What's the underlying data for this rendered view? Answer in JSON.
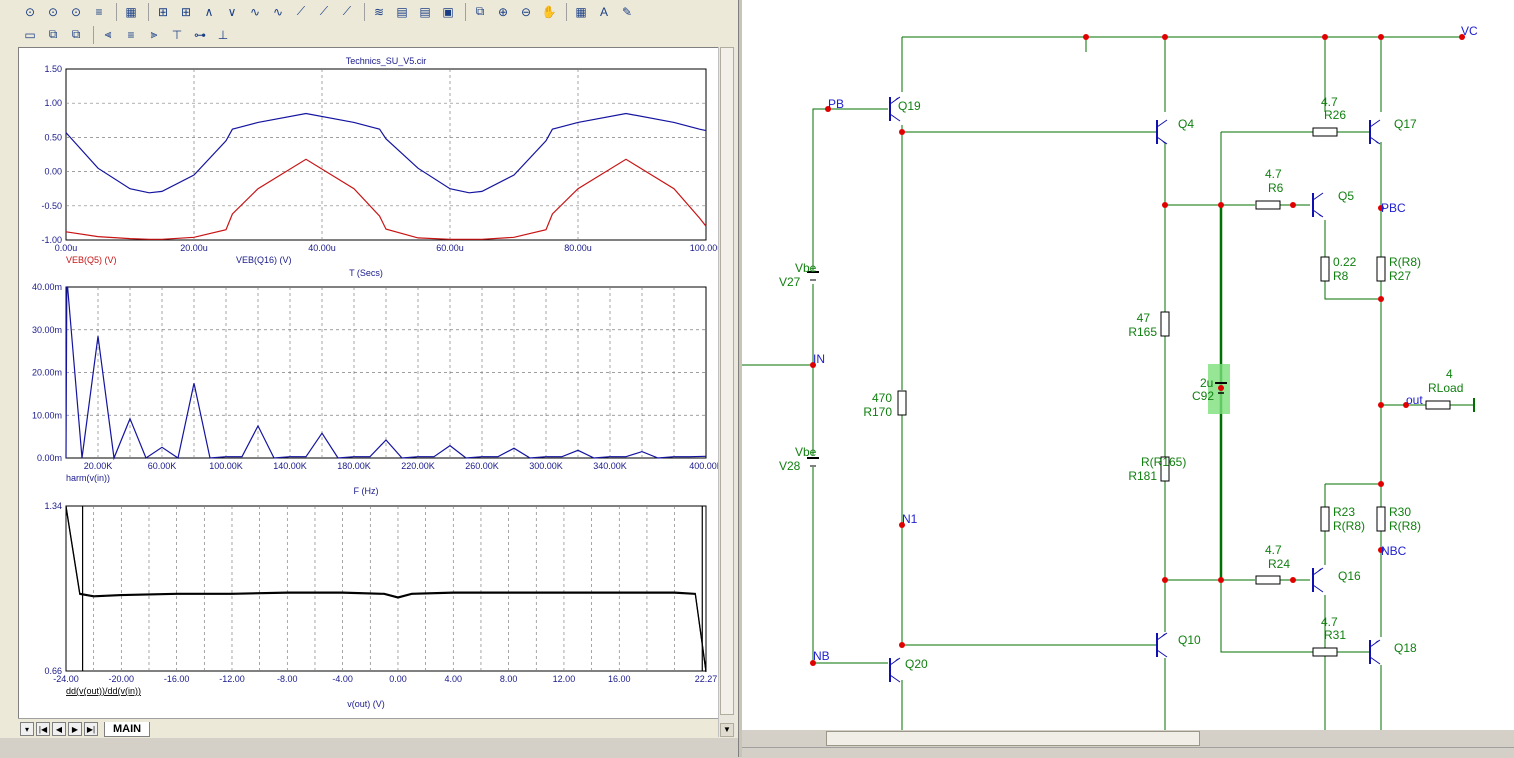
{
  "toolbar": {
    "row1_icons": [
      "zoom-fit-icon",
      "zoom-region-icon",
      "zoom-out-icon",
      "scale-icon",
      "properties-icon",
      "cursor-peak-icon",
      "cursor-valley-icon",
      "cursor-high-icon",
      "cursor-low-icon",
      "cursor-inflection-icon",
      "cursor-slope-icon",
      "cursor-top-icon",
      "cursor-bottom-icon",
      "cursor-global-icon",
      "label-icon",
      "notes-icon",
      "print-icon",
      "page-setup-icon",
      "copy-icon",
      "zoom-in-icon",
      "zoom-out-2-icon",
      "pan-icon",
      "grid-icon",
      "font-icon",
      "tag-icon"
    ],
    "row2_icons": [
      "bring-front-icon",
      "group-icon",
      "ungroup-icon",
      "align-left-icon",
      "align-center-icon",
      "align-right-icon",
      "align-top-icon",
      "align-middle-icon",
      "align-bottom-icon"
    ]
  },
  "plot1": {
    "title": "Technics_SU_V5.cir",
    "y_ticks": [
      "1.50",
      "1.00",
      "0.50",
      "0.00",
      "-0.50",
      "-1.00"
    ],
    "x_ticks": [
      "0.00u",
      "20.00u",
      "40.00u",
      "60.00u",
      "80.00u",
      "100.00u"
    ],
    "legend_red": "VEB(Q5) (V)",
    "legend_blue": "VEB(Q16) (V)",
    "xlabel": "T (Secs)",
    "colors": {
      "series1": "#c81414",
      "series2": "#1414a0"
    }
  },
  "plot2": {
    "y_ticks": [
      "40.00m",
      "30.00m",
      "20.00m",
      "10.00m",
      "0.00m"
    ],
    "x_ticks": [
      "20.00K",
      "60.00K",
      "100.00K",
      "140.00K",
      "180.00K",
      "220.00K",
      "260.00K",
      "300.00K",
      "340.00K",
      "400.00K"
    ],
    "legend": "harm(v(in))",
    "xlabel": "F (Hz)",
    "colors": {
      "series1": "#1414a0"
    }
  },
  "plot3": {
    "y_top": "1.34",
    "y_bottom": "0.66",
    "x_ticks": [
      "-24.00",
      "-20.00",
      "-16.00",
      "-12.00",
      "-8.00",
      "-4.00",
      "0.00",
      "4.00",
      "8.00",
      "12.00",
      "16.00",
      "22.27"
    ],
    "legend": "dd(v(out))/dd(v(in))",
    "xlabel": "v(out) (V)"
  },
  "chart_data": [
    {
      "type": "line",
      "title": "Technics_SU_V5.cir",
      "xlabel": "T (Secs)",
      "ylabel": "",
      "xlim": [
        0,
        100
      ],
      "ylim": [
        -1.0,
        1.5
      ],
      "x_unit": "u",
      "x": [
        0,
        5,
        10,
        13,
        15,
        20,
        25,
        26,
        30,
        37.5,
        45,
        49,
        50,
        55,
        60,
        63,
        65,
        70,
        75,
        76,
        80,
        87.5,
        95,
        99,
        100
      ],
      "series": [
        {
          "name": "VEB(Q5) (V)",
          "values": [
            -0.88,
            -0.95,
            -0.98,
            -0.99,
            -0.99,
            -0.96,
            -0.85,
            -0.62,
            -0.25,
            0.18,
            -0.25,
            -0.65,
            -0.84,
            -0.97,
            -0.99,
            -0.99,
            -0.99,
            -0.96,
            -0.85,
            -0.62,
            -0.25,
            0.18,
            -0.25,
            -0.68,
            -0.8
          ]
        },
        {
          "name": "VEB(Q16) (V)",
          "values": [
            0.57,
            0.05,
            -0.25,
            -0.31,
            -0.29,
            -0.05,
            0.45,
            0.62,
            0.72,
            0.85,
            0.72,
            0.62,
            0.48,
            0.05,
            -0.25,
            -0.31,
            -0.29,
            -0.05,
            0.45,
            0.62,
            0.72,
            0.85,
            0.72,
            0.62,
            0.6
          ]
        }
      ]
    },
    {
      "type": "line",
      "xlabel": "F (Hz)",
      "ylabel": "",
      "xlim": [
        0,
        400
      ],
      "ylim": [
        0,
        40
      ],
      "x_unit": "K",
      "x": [
        0,
        0.5,
        1,
        10,
        20,
        30,
        40,
        50,
        60,
        70,
        80,
        90,
        100,
        110,
        120,
        130,
        140,
        150,
        160,
        170,
        180,
        190,
        200,
        210,
        220,
        230,
        240,
        250,
        260,
        270,
        280,
        290,
        300,
        310,
        320,
        330,
        340,
        350,
        360,
        370,
        380,
        390,
        400
      ],
      "series": [
        {
          "name": "harm(v(in))",
          "values": [
            0,
            40,
            40,
            0,
            28.5,
            0,
            9.2,
            0,
            2.5,
            0,
            17.5,
            0,
            0.3,
            0.3,
            7.5,
            0,
            0.3,
            0.3,
            5.8,
            0,
            0.3,
            0.3,
            4.2,
            0,
            0.3,
            0.3,
            2.9,
            0,
            0.3,
            0.3,
            2.3,
            0,
            0.3,
            0.3,
            1.8,
            0,
            0.3,
            0.3,
            1.5,
            0,
            0.3,
            0.3,
            0.4
          ]
        }
      ]
    },
    {
      "type": "line",
      "xlabel": "v(out) (V)",
      "ylabel": "",
      "xlim": [
        -24,
        22.27
      ],
      "ylim": [
        0.66,
        1.34
      ],
      "x": [
        -24,
        -23,
        -22,
        -20,
        -16,
        -12,
        -8,
        -4,
        -1,
        0,
        1,
        4,
        8,
        12,
        16,
        20,
        21.5,
        22.27
      ],
      "series": [
        {
          "name": "dd(v(out))/dd(v(in))",
          "values": [
            1.34,
            0.98,
            0.97,
            0.975,
            0.98,
            0.98,
            0.985,
            0.985,
            0.98,
            0.965,
            0.98,
            0.985,
            0.985,
            0.985,
            0.985,
            0.985,
            0.98,
            0.66
          ]
        }
      ]
    }
  ],
  "schematic": {
    "labels": {
      "vc": "VC",
      "pb": "PB",
      "in": "IN",
      "nb": "NB",
      "n1": "N1",
      "pbc": "PBC",
      "nbc": "NBC",
      "out": "out"
    },
    "parts": {
      "q19": "Q19",
      "q4": "Q4",
      "q17": "Q17",
      "q5": "Q5",
      "q16": "Q16",
      "q10": "Q10",
      "q18": "Q18",
      "q20": "Q20",
      "r26v": "4.7",
      "r26": "R26",
      "r6v": "4.7",
      "r6": "R6",
      "r8v": "0.22",
      "r8": "R8",
      "r27v": "R(R8)",
      "r27": "R27",
      "r165v": "47",
      "r165": "R165",
      "c92v": "2u",
      "c92": "C92",
      "rloadv": "4",
      "rload": "RLoad",
      "r170v": "470",
      "r170": "R170",
      "r181v": "R(R165)",
      "r181": "R181",
      "r23": "R23",
      "r23v": "R(R8)",
      "r30": "R30",
      "r30v": "R(R8)",
      "r24v": "4.7",
      "r24": "R24",
      "r31v": "4.7",
      "r31": "R31",
      "v27v": "Vbe",
      "v27": "V27",
      "v28v": "Vbe",
      "v28": "V28"
    },
    "colors": {
      "wire": "#007000",
      "label": "#2020d0",
      "part": "#108010",
      "node": "#e00000",
      "highlight": "#7ce07c"
    }
  },
  "tabs": {
    "main": "MAIN"
  }
}
